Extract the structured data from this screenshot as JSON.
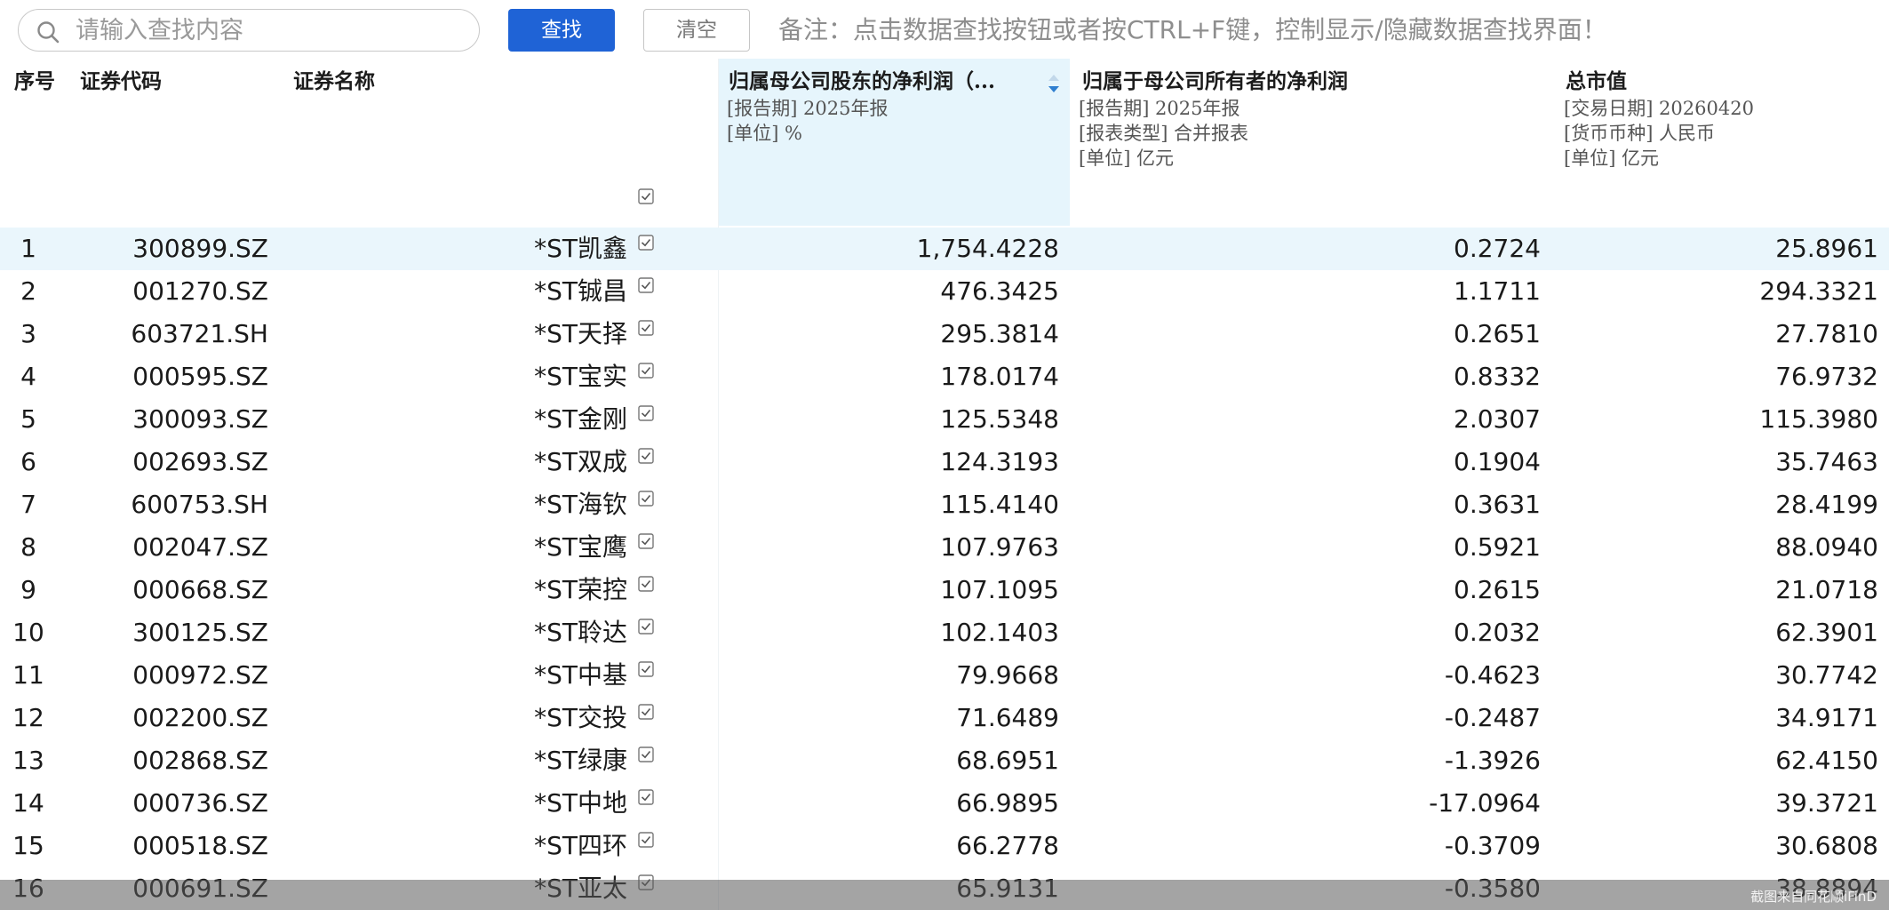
{
  "toolbar": {
    "search_placeholder": "请输入查找内容",
    "search_value": "",
    "find_label": "查找",
    "clear_label": "清空",
    "note": "备注：点击数据查找按钮或者按CTRL+F键，控制显示/隐藏数据查找界面！"
  },
  "header": {
    "seq": "序号",
    "code": "证券代码",
    "name": "证券名称",
    "profit": {
      "title": "归属母公司股东的净利润（...",
      "params": [
        "[报告期]  2025年报",
        "[单位]  %"
      ]
    },
    "netp": {
      "title": "归属于母公司所有者的净利润",
      "params": [
        "[报告期]  2025年报",
        "[报表类型]  合并报表",
        "[单位]  亿元"
      ]
    },
    "mcap": {
      "title": "总市值",
      "params": [
        "[交易日期]  20260420",
        "[货币币种]  人民币",
        "[单位]  亿元"
      ]
    }
  },
  "rows": [
    {
      "seq": "1",
      "code": "300899.SZ",
      "name": "*ST凯鑫",
      "profit": "1,754.4228",
      "netp": "0.2724",
      "mcap": "25.8961"
    },
    {
      "seq": "2",
      "code": "001270.SZ",
      "name": "*ST铖昌",
      "profit": "476.3425",
      "netp": "1.1711",
      "mcap": "294.3321"
    },
    {
      "seq": "3",
      "code": "603721.SH",
      "name": "*ST天择",
      "profit": "295.3814",
      "netp": "0.2651",
      "mcap": "27.7810"
    },
    {
      "seq": "4",
      "code": "000595.SZ",
      "name": "*ST宝实",
      "profit": "178.0174",
      "netp": "0.8332",
      "mcap": "76.9732"
    },
    {
      "seq": "5",
      "code": "300093.SZ",
      "name": "*ST金刚",
      "profit": "125.5348",
      "netp": "2.0307",
      "mcap": "115.3980"
    },
    {
      "seq": "6",
      "code": "002693.SZ",
      "name": "*ST双成",
      "profit": "124.3193",
      "netp": "0.1904",
      "mcap": "35.7463"
    },
    {
      "seq": "7",
      "code": "600753.SH",
      "name": "*ST海钦",
      "profit": "115.4140",
      "netp": "0.3631",
      "mcap": "28.4199"
    },
    {
      "seq": "8",
      "code": "002047.SZ",
      "name": "*ST宝鹰",
      "profit": "107.9763",
      "netp": "0.5921",
      "mcap": "88.0940"
    },
    {
      "seq": "9",
      "code": "000668.SZ",
      "name": "*ST荣控",
      "profit": "107.1095",
      "netp": "0.2615",
      "mcap": "21.0718"
    },
    {
      "seq": "10",
      "code": "300125.SZ",
      "name": "*ST聆达",
      "profit": "102.1403",
      "netp": "0.2032",
      "mcap": "62.3901"
    },
    {
      "seq": "11",
      "code": "000972.SZ",
      "name": "*ST中基",
      "profit": "79.9668",
      "netp": "-0.4623",
      "mcap": "30.7742"
    },
    {
      "seq": "12",
      "code": "002200.SZ",
      "name": "*ST交投",
      "profit": "71.6489",
      "netp": "-0.2487",
      "mcap": "34.9171"
    },
    {
      "seq": "13",
      "code": "002868.SZ",
      "name": "*ST绿康",
      "profit": "68.6951",
      "netp": "-1.3926",
      "mcap": "62.4150"
    },
    {
      "seq": "14",
      "code": "000736.SZ",
      "name": "*ST中地",
      "profit": "66.9895",
      "netp": "-17.0964",
      "mcap": "39.3721"
    },
    {
      "seq": "15",
      "code": "000518.SZ",
      "name": "*ST四环",
      "profit": "66.2778",
      "netp": "-0.3709",
      "mcap": "30.6808"
    },
    {
      "seq": "16",
      "code": "000691.SZ",
      "name": "*ST亚太",
      "profit": "65.9131",
      "netp": "-0.3580",
      "mcap": "38.8894"
    }
  ],
  "watermark": "截图来自同花顺iFinD",
  "colors": {
    "accent": "#1f63d6",
    "sorted_column_bg": "#e6f5fc",
    "selected_row_bg": "#eaf6fc",
    "note_text": "#8e8e8e"
  },
  "icons": {
    "search": "search-icon",
    "sort": "sort-desc-icon",
    "checkbox": "checkbox-checked-icon"
  }
}
